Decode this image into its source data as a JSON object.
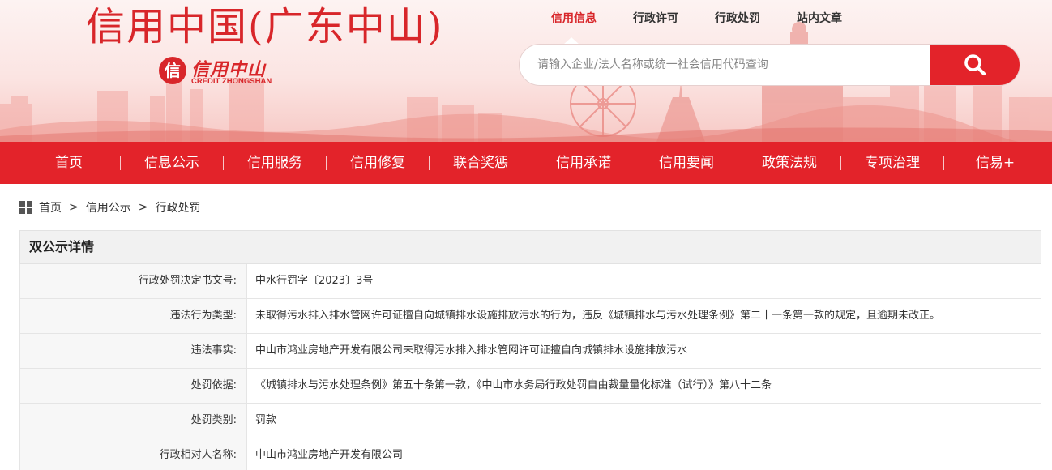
{
  "header": {
    "site_title": "信用中国(广东中山)",
    "logo_cn": "信用中山",
    "logo_en": "CREDIT ZHONGSHAN",
    "top_links": [
      {
        "label": "信用信息",
        "active": true
      },
      {
        "label": "行政许可",
        "active": false
      },
      {
        "label": "行政处罚",
        "active": false
      },
      {
        "label": "站内文章",
        "active": false
      }
    ],
    "search": {
      "placeholder": "请输入企业/法人名称或统一社会信用代码查询",
      "value": "",
      "button_icon": "search-icon"
    }
  },
  "nav": {
    "items": [
      "首页",
      "信息公示",
      "信用服务",
      "信用修复",
      "联合奖惩",
      "信用承诺",
      "信用要闻",
      "政策法规",
      "专项治理",
      "信易+"
    ]
  },
  "breadcrumb": {
    "icon": "grid-icon",
    "items": [
      "首页",
      "信用公示",
      "行政处罚"
    ],
    "separator": ">"
  },
  "detail": {
    "heading": "双公示详情",
    "rows": [
      {
        "label": "行政处罚决定书文号:",
        "value": "中水行罚字〔2023〕3号"
      },
      {
        "label": "违法行为类型:",
        "value": "未取得污水排入排水管网许可证擅自向城镇排水设施排放污水的行为，违反《城镇排水与污水处理条例》第二十一条第一款的规定，且逾期未改正。"
      },
      {
        "label": "违法事实:",
        "value": "中山市鸿业房地产开发有限公司未取得污水排入排水管网许可证擅自向城镇排水设施排放污水"
      },
      {
        "label": "处罚依据:",
        "value": "《城镇排水与污水处理条例》第五十条第一款，《中山市水务局行政处罚自由裁量量化标准（试行）》第八十二条"
      },
      {
        "label": "处罚类别:",
        "value": "罚款"
      },
      {
        "label": "行政相对人名称:",
        "value": "中山市鸿业房地产开发有限公司"
      }
    ]
  },
  "colors": {
    "brand_red": "#e3232a",
    "title_red": "#d8262a",
    "label_bg": "#f7f7f7",
    "heading_bg": "#f1f1f1"
  }
}
